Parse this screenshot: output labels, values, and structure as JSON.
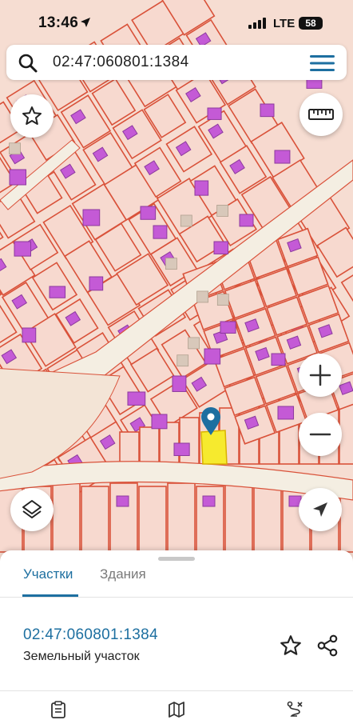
{
  "status_bar": {
    "time": "13:46",
    "network": "LTE",
    "battery": "58"
  },
  "search": {
    "query": "02:47:060801:1384"
  },
  "sheet": {
    "tabs": [
      {
        "label": "Участки",
        "active": true
      },
      {
        "label": "Здания",
        "active": false
      }
    ],
    "parcel": {
      "number": "02:47:060801:1384",
      "type": "Земельный участок"
    },
    "nav": [
      {
        "label": "",
        "icon": "clipboard-icon"
      },
      {
        "label": "",
        "icon": "map-icon"
      },
      {
        "label": "",
        "icon": "route-icon"
      }
    ]
  },
  "map": {
    "icons": [
      "star-icon",
      "ruler-icon",
      "zoom-in-icon",
      "zoom-out-icon",
      "layers-icon",
      "locate-icon",
      "map-pin-icon"
    ],
    "colors": {
      "parcel_fill": "#f7d9cf",
      "parcel_border": "#d9523a",
      "building": "#c45ad6",
      "road": "#f4eee2",
      "selected_parcel": "#f6ea2e",
      "pin": "#1d6fa0",
      "accent": "#1d6fa0"
    }
  }
}
